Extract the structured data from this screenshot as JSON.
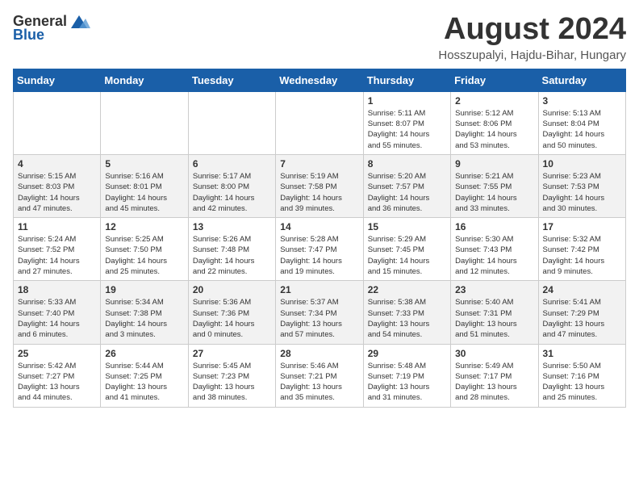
{
  "header": {
    "logo_general": "General",
    "logo_blue": "Blue",
    "month_title": "August 2024",
    "location": "Hosszupalyi, Hajdu-Bihar, Hungary"
  },
  "days_of_week": [
    "Sunday",
    "Monday",
    "Tuesday",
    "Wednesday",
    "Thursday",
    "Friday",
    "Saturday"
  ],
  "weeks": [
    [
      {
        "day": "",
        "info": ""
      },
      {
        "day": "",
        "info": ""
      },
      {
        "day": "",
        "info": ""
      },
      {
        "day": "",
        "info": ""
      },
      {
        "day": "1",
        "info": "Sunrise: 5:11 AM\nSunset: 8:07 PM\nDaylight: 14 hours\nand 55 minutes."
      },
      {
        "day": "2",
        "info": "Sunrise: 5:12 AM\nSunset: 8:06 PM\nDaylight: 14 hours\nand 53 minutes."
      },
      {
        "day": "3",
        "info": "Sunrise: 5:13 AM\nSunset: 8:04 PM\nDaylight: 14 hours\nand 50 minutes."
      }
    ],
    [
      {
        "day": "4",
        "info": "Sunrise: 5:15 AM\nSunset: 8:03 PM\nDaylight: 14 hours\nand 47 minutes."
      },
      {
        "day": "5",
        "info": "Sunrise: 5:16 AM\nSunset: 8:01 PM\nDaylight: 14 hours\nand 45 minutes."
      },
      {
        "day": "6",
        "info": "Sunrise: 5:17 AM\nSunset: 8:00 PM\nDaylight: 14 hours\nand 42 minutes."
      },
      {
        "day": "7",
        "info": "Sunrise: 5:19 AM\nSunset: 7:58 PM\nDaylight: 14 hours\nand 39 minutes."
      },
      {
        "day": "8",
        "info": "Sunrise: 5:20 AM\nSunset: 7:57 PM\nDaylight: 14 hours\nand 36 minutes."
      },
      {
        "day": "9",
        "info": "Sunrise: 5:21 AM\nSunset: 7:55 PM\nDaylight: 14 hours\nand 33 minutes."
      },
      {
        "day": "10",
        "info": "Sunrise: 5:23 AM\nSunset: 7:53 PM\nDaylight: 14 hours\nand 30 minutes."
      }
    ],
    [
      {
        "day": "11",
        "info": "Sunrise: 5:24 AM\nSunset: 7:52 PM\nDaylight: 14 hours\nand 27 minutes."
      },
      {
        "day": "12",
        "info": "Sunrise: 5:25 AM\nSunset: 7:50 PM\nDaylight: 14 hours\nand 25 minutes."
      },
      {
        "day": "13",
        "info": "Sunrise: 5:26 AM\nSunset: 7:48 PM\nDaylight: 14 hours\nand 22 minutes."
      },
      {
        "day": "14",
        "info": "Sunrise: 5:28 AM\nSunset: 7:47 PM\nDaylight: 14 hours\nand 19 minutes."
      },
      {
        "day": "15",
        "info": "Sunrise: 5:29 AM\nSunset: 7:45 PM\nDaylight: 14 hours\nand 15 minutes."
      },
      {
        "day": "16",
        "info": "Sunrise: 5:30 AM\nSunset: 7:43 PM\nDaylight: 14 hours\nand 12 minutes."
      },
      {
        "day": "17",
        "info": "Sunrise: 5:32 AM\nSunset: 7:42 PM\nDaylight: 14 hours\nand 9 minutes."
      }
    ],
    [
      {
        "day": "18",
        "info": "Sunrise: 5:33 AM\nSunset: 7:40 PM\nDaylight: 14 hours\nand 6 minutes."
      },
      {
        "day": "19",
        "info": "Sunrise: 5:34 AM\nSunset: 7:38 PM\nDaylight: 14 hours\nand 3 minutes."
      },
      {
        "day": "20",
        "info": "Sunrise: 5:36 AM\nSunset: 7:36 PM\nDaylight: 14 hours\nand 0 minutes."
      },
      {
        "day": "21",
        "info": "Sunrise: 5:37 AM\nSunset: 7:34 PM\nDaylight: 13 hours\nand 57 minutes."
      },
      {
        "day": "22",
        "info": "Sunrise: 5:38 AM\nSunset: 7:33 PM\nDaylight: 13 hours\nand 54 minutes."
      },
      {
        "day": "23",
        "info": "Sunrise: 5:40 AM\nSunset: 7:31 PM\nDaylight: 13 hours\nand 51 minutes."
      },
      {
        "day": "24",
        "info": "Sunrise: 5:41 AM\nSunset: 7:29 PM\nDaylight: 13 hours\nand 47 minutes."
      }
    ],
    [
      {
        "day": "25",
        "info": "Sunrise: 5:42 AM\nSunset: 7:27 PM\nDaylight: 13 hours\nand 44 minutes."
      },
      {
        "day": "26",
        "info": "Sunrise: 5:44 AM\nSunset: 7:25 PM\nDaylight: 13 hours\nand 41 minutes."
      },
      {
        "day": "27",
        "info": "Sunrise: 5:45 AM\nSunset: 7:23 PM\nDaylight: 13 hours\nand 38 minutes."
      },
      {
        "day": "28",
        "info": "Sunrise: 5:46 AM\nSunset: 7:21 PM\nDaylight: 13 hours\nand 35 minutes."
      },
      {
        "day": "29",
        "info": "Sunrise: 5:48 AM\nSunset: 7:19 PM\nDaylight: 13 hours\nand 31 minutes."
      },
      {
        "day": "30",
        "info": "Sunrise: 5:49 AM\nSunset: 7:17 PM\nDaylight: 13 hours\nand 28 minutes."
      },
      {
        "day": "31",
        "info": "Sunrise: 5:50 AM\nSunset: 7:16 PM\nDaylight: 13 hours\nand 25 minutes."
      }
    ]
  ]
}
